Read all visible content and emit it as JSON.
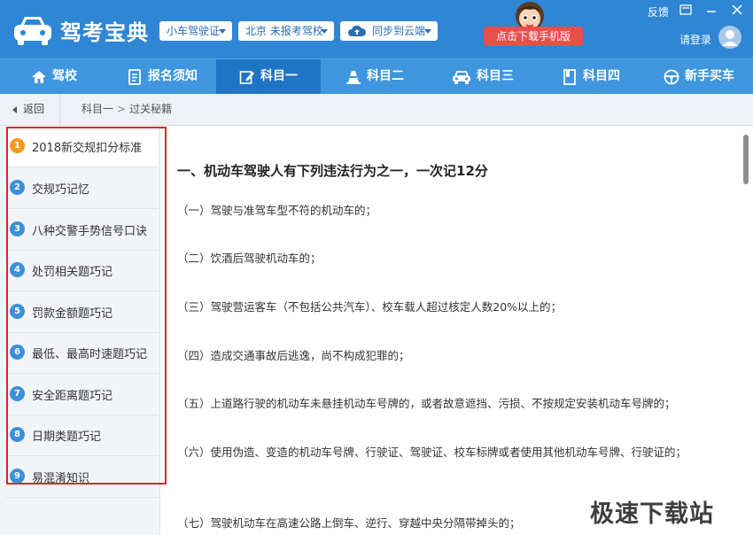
{
  "app": {
    "title": "驾考宝典",
    "dropdown_cert": "小车驾驶证",
    "dropdown_school": "北京 未报考驾校",
    "dropdown_sync": "同步到云端",
    "download_button": "点击下载手机版",
    "feedback": "反馈",
    "login": "请登录"
  },
  "nav": {
    "items": [
      {
        "label": "驾校",
        "icon": "home-icon"
      },
      {
        "label": "报名须知",
        "icon": "document-icon"
      },
      {
        "label": "科目一",
        "icon": "edit-icon",
        "active": true
      },
      {
        "label": "科目二",
        "icon": "cone-icon"
      },
      {
        "label": "科目三",
        "icon": "car-icon"
      },
      {
        "label": "科目四",
        "icon": "book-icon"
      },
      {
        "label": "新手买车",
        "icon": "steering-wheel-icon"
      }
    ]
  },
  "breadcrumb": {
    "back": "返回",
    "level1": "科目一",
    "separator": ">",
    "level2": "过关秘籍"
  },
  "sidebar": {
    "items": [
      {
        "num": "1",
        "label": "2018新交规扣分标准"
      },
      {
        "num": "2",
        "label": "交规巧记忆"
      },
      {
        "num": "3",
        "label": "八种交警手势信号口诀"
      },
      {
        "num": "4",
        "label": "处罚相关题巧记"
      },
      {
        "num": "5",
        "label": "罚款金额题巧记"
      },
      {
        "num": "6",
        "label": "最低、最高时速题巧记"
      },
      {
        "num": "7",
        "label": "安全距离题巧记"
      },
      {
        "num": "8",
        "label": "日期类题巧记"
      },
      {
        "num": "9",
        "label": "易混淆知识"
      }
    ]
  },
  "content": {
    "heading": "一、机动车驾驶人有下列违法行为之一，一次记12分",
    "paragraphs": [
      "（一）驾驶与准驾车型不符的机动车的；",
      "（二）饮酒后驾驶机动车的；",
      "（三）驾驶营运客车（不包括公共汽车）、校车载人超过核定人数20%以上的；",
      "（四）造成交通事故后逃逸，尚不构成犯罪的；",
      "（五）上道路行驶的机动车未悬挂机动车号牌的，或者故意遮挡、污损、不按规定安装机动车号牌的；",
      "（六）使用伪造、变造的机动车号牌、行驶证、驾驶证、校车标牌或者使用其他机动车号牌、行驶证的；",
      "（七）驾驶机动车在高速公路上倒车、逆行、穿越中央分隔带掉头的；"
    ]
  },
  "watermark": "极速下载站",
  "colors": {
    "titlebar": "#2e86d4",
    "navbar": "#3f96de",
    "nav_active": "#2074c4",
    "download": "#e94e4e",
    "highlight": "#e0222c",
    "badge_active": "#f39a1d",
    "badge": "#3d8fd9"
  }
}
